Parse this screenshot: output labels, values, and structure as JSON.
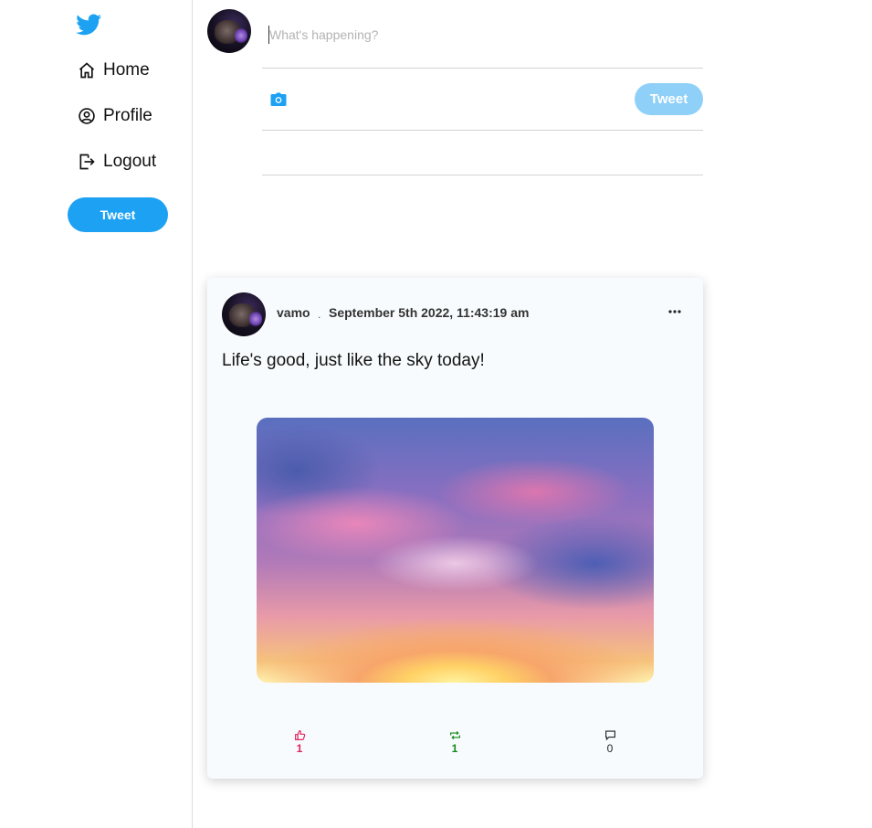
{
  "sidebar": {
    "nav": [
      {
        "label": "Home",
        "icon": "home-icon"
      },
      {
        "label": "Profile",
        "icon": "profile-icon"
      },
      {
        "label": "Logout",
        "icon": "logout-icon"
      }
    ],
    "tweet_button_label": "Tweet"
  },
  "composer": {
    "placeholder": "What's happening?",
    "tweet_button_label": "Tweet"
  },
  "post": {
    "username": "vamo",
    "separator": ".",
    "timestamp": "September 5th 2022, 11:43:19 am",
    "text": "Life's good, just like the sky today!",
    "likes": "1",
    "retweets": "1",
    "replies": "0"
  },
  "colors": {
    "brand": "#1da1f2",
    "like": "#e0245e",
    "retweet": "#118a1a"
  }
}
